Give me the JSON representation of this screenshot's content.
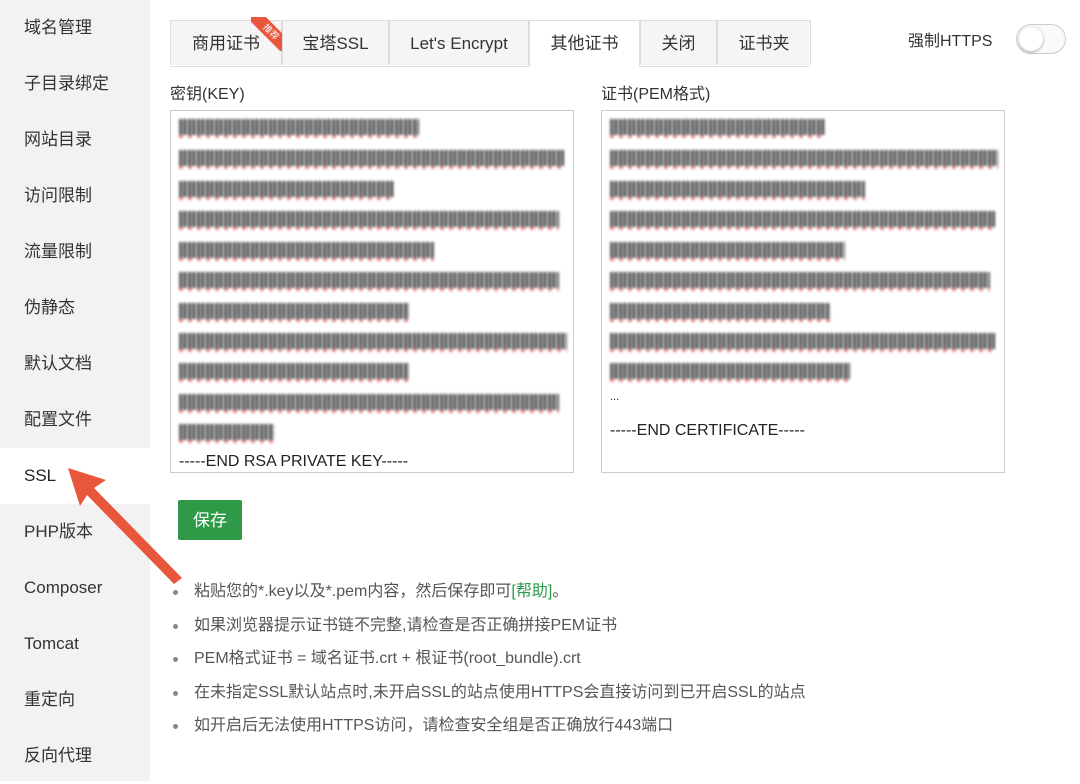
{
  "sidebar": {
    "items": [
      {
        "label": "域名管理"
      },
      {
        "label": "子目录绑定"
      },
      {
        "label": "网站目录"
      },
      {
        "label": "访问限制"
      },
      {
        "label": "流量限制"
      },
      {
        "label": "伪静态"
      },
      {
        "label": "默认文档"
      },
      {
        "label": "配置文件"
      },
      {
        "label": "SSL"
      },
      {
        "label": "PHP版本"
      },
      {
        "label": "Composer"
      },
      {
        "label": "Tomcat"
      },
      {
        "label": "重定向"
      },
      {
        "label": "反向代理"
      }
    ],
    "active_item": "SSL"
  },
  "tabs": {
    "items": [
      {
        "label": "商用证书",
        "ribbon": "推荐"
      },
      {
        "label": "宝塔SSL"
      },
      {
        "label": "Let's Encrypt"
      },
      {
        "label": "其他证书"
      },
      {
        "label": "关闭"
      },
      {
        "label": "证书夹"
      }
    ],
    "active_tab": "其他证书"
  },
  "force_https": {
    "label": "强制HTTPS",
    "enabled": false
  },
  "key_field": {
    "label": "密钥(KEY)",
    "end_line": "-----END RSA PRIVATE KEY-----"
  },
  "cert_field": {
    "label": "证书(PEM格式)",
    "tail_fragment": "...",
    "end_line": "-----END CERTIFICATE-----"
  },
  "save_button": {
    "label": "保存",
    "color": "#2e9a47"
  },
  "tips": {
    "item1_before": "粘贴您的*.key以及*.pem内容，然后保存即可",
    "item1_link": "[帮助]",
    "item1_after": "。",
    "items": [
      "如果浏览器提示证书链不完整,请检查是否正确拼接PEM证书",
      "PEM格式证书 = 域名证书.crt + 根证书(root_bundle).crt",
      "在未指定SSL默认站点时,未开启SSL的站点使用HTTPS会直接访问到已开启SSL的站点",
      "如开启后无法使用HTTPS访问，请检查安全组是否正确放行443端口"
    ]
  },
  "colors": {
    "accent_green": "#2e9a47",
    "arrow_red": "#e8563c",
    "sidebar_bg": "#f2f2f2"
  }
}
